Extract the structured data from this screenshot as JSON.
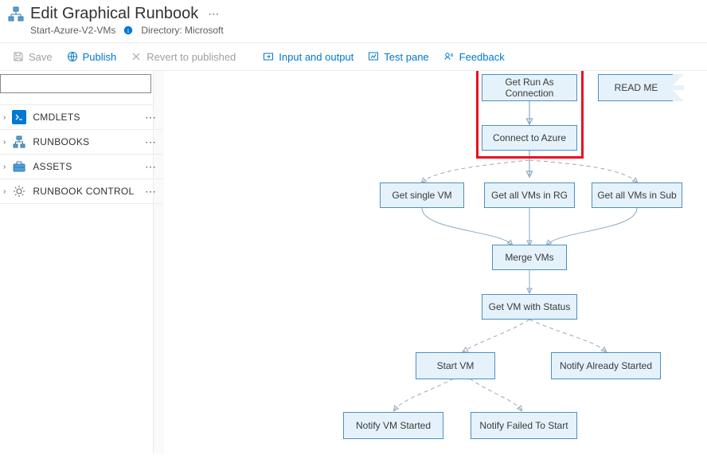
{
  "header": {
    "title": "Edit Graphical Runbook",
    "subtitle_runbook": "Start-Azure-V2-VMs",
    "directory_label": "Directory: Microsoft"
  },
  "toolbar": {
    "save": "Save",
    "publish": "Publish",
    "revert": "Revert to published",
    "input_output": "Input and output",
    "test_pane": "Test pane",
    "feedback": "Feedback"
  },
  "sidebar": {
    "search_value": "",
    "items": [
      {
        "label": "CMDLETS",
        "icon": "cmdlets-icon",
        "color": "#0078d4"
      },
      {
        "label": "RUNBOOKS",
        "icon": "runbooks-icon",
        "color": "#0078d4"
      },
      {
        "label": "ASSETS",
        "icon": "assets-icon",
        "color": "#0078d4"
      },
      {
        "label": "RUNBOOK CONTROL",
        "icon": "gear-icon",
        "color": "#605e5c"
      }
    ]
  },
  "canvas": {
    "nodes": {
      "get_run_as": "Get Run As Connection",
      "connect_azure": "Connect to Azure",
      "readme": "READ ME",
      "get_single_vm": "Get single VM",
      "get_all_rg": "Get all VMs in RG",
      "get_all_sub": "Get all VMs in Sub",
      "merge_vms": "Merge VMs",
      "get_vm_status": "Get VM with Status",
      "start_vm": "Start VM",
      "notify_already": "Notify Already Started",
      "notify_started": "Notify VM Started",
      "notify_failed": "Notify Failed To Start"
    },
    "highlighted_group": [
      "get_run_as",
      "connect_azure"
    ]
  }
}
